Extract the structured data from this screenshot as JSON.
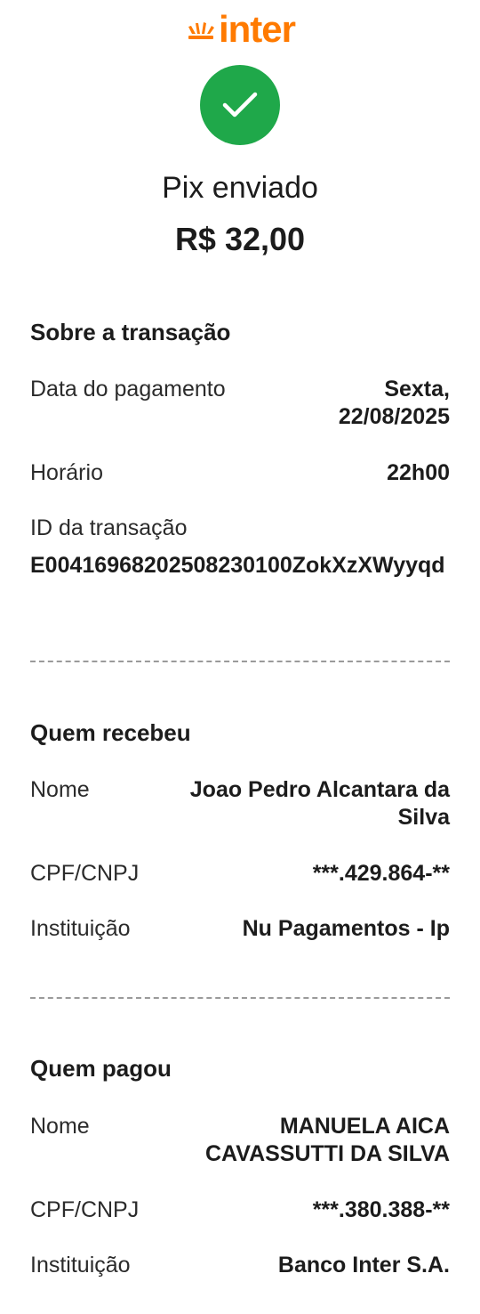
{
  "brand": {
    "name": "inter",
    "color": "#ff7a00"
  },
  "status": {
    "icon": "check-icon",
    "color": "#1fa84a",
    "title": "Pix enviado",
    "amount": "R$ 32,00"
  },
  "transaction": {
    "section_title": "Sobre a transação",
    "date_label": "Data do pagamento",
    "date_value": "Sexta, 22/08/2025",
    "time_label": "Horário",
    "time_value": "22h00",
    "id_label": "ID da transação",
    "id_value": "E00416968202508230100ZokXzXWyyqd"
  },
  "receiver": {
    "section_title": "Quem recebeu",
    "name_label": "Nome",
    "name_value": "Joao Pedro Alcantara da Silva",
    "doc_label": "CPF/CNPJ",
    "doc_value": "***.429.864-**",
    "inst_label": "Instituição",
    "inst_value": "Nu Pagamentos - Ip"
  },
  "payer": {
    "section_title": "Quem pagou",
    "name_label": "Nome",
    "name_value": "MANUELA AICA CAVASSUTTI DA SILVA",
    "doc_label": "CPF/CNPJ",
    "doc_value": "***.380.388-**",
    "inst_label": "Instituição",
    "inst_value": "Banco Inter S.A."
  }
}
